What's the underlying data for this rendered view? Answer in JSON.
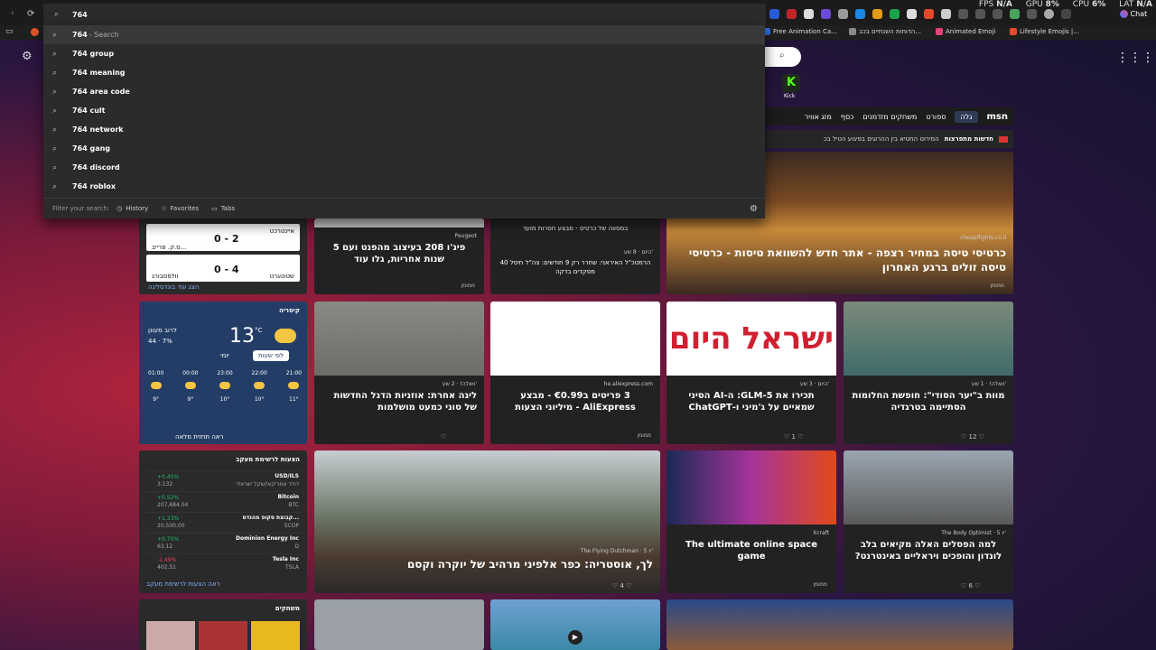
{
  "browser": {
    "typed_query": "764",
    "perf": {
      "fps_label": "FPS",
      "fps": "N/A",
      "gpu_label": "GPU",
      "gpu": "8%",
      "cpu_label": "CPU",
      "cpu": "6%",
      "lat_label": "LAT",
      "lat": "N/A"
    },
    "chat_label": "Chat",
    "bookmarks": [
      "Free Animation Ca...",
      "הדוחות השנתיים בכב...",
      "Animated Emoji",
      "Lifestyle Emojis |..."
    ]
  },
  "suggestions": {
    "first": {
      "text": "764",
      "suffix": " - Search"
    },
    "items": [
      "764 group",
      "764 meaning",
      "764 area code",
      "764 cult",
      "764 network",
      "764 gang",
      "764 discord",
      "764 roblox"
    ],
    "filter_label": "Filter your search:",
    "filters": [
      "History",
      "Favorites",
      "Tabs"
    ]
  },
  "page": {
    "kick_label": "Kick",
    "msn": {
      "logo": "msn",
      "tabs": [
        "גלה",
        "ספורט",
        "משחקים מזדמנים",
        "כסף",
        "מזג אוויר"
      ]
    },
    "ticker": {
      "label": "חדשות מתפרצות",
      "text": "המירוט החטיא בין ההרוגים בפיגוע הטיל בכ"
    },
    "sports": {
      "team1": "איינטרכט",
      "score1": "0 - 2",
      "team2": "ס.ק. פרייב...",
      "team3": "שטוטגרט",
      "score2": "0 - 4",
      "team4": "וולפסבורג",
      "more": "הצג עוד בונדסליגה"
    },
    "cards": [
      {
        "title": "פיג'ו 208 בעיצוב מהפנט ועם 5 שנות אחריות, גלו עוד",
        "src": "Peugeot",
        "foot": "ממומן"
      },
      {
        "title": "במסווה של כרטיס - מבצע חסרות מועד",
        "sub": "הרמטכ\"ל האיראני: שחרר רק 9 חודשים: צה\"ל חיסל 40 מפקדים בדקה",
        "src": "היום · 8 שע'"
      },
      {
        "title": "כרטיסי טיסה במחיר רצפה - אתר חדש להשוואת טיסות - כרטיסי טיסה זולים ברגע האחרון",
        "src": "cheapflights.co.il",
        "foot": "ממומן"
      },
      {
        "title": "ליגה אחרת: אוזניות הדגל החדשות של סוני כמעט מושלמות",
        "src": "וואלה! · 2 שע'",
        "likes": ""
      },
      {
        "title": "3 פריטים ב‎€0.99 - מבצע AliExpress - מיליוני הצעות",
        "src": "he.aliexpress.com",
        "foot": "ממומן"
      },
      {
        "title": "תכירו את GLM-5: ה-AI הסיני שמאיים על ג'מיני ו-ChatGPT",
        "src": "היום · 3 שע'",
        "likes": "1"
      },
      {
        "title": "מוות ב\"יער הסודי\": חופשת החלומות הסתיימה בטרגדיה",
        "src": "וואלה! · 1 שע'",
        "likes": "12"
      },
      {
        "title": "לך, אוסטריה: כפר אלפיני מרהיב של יוקרה וקסם",
        "src": "The Flying Dutchman · 5 יו'",
        "likes": "4"
      },
      {
        "title": "The ultimate online space game",
        "src": "Xcraft",
        "foot": "ממומן"
      },
      {
        "title": "למה הפסלים האלה מקיאים בלב לונדון והופכים ויראליים באינטרנט?",
        "src": "The Body Optimist · 5 יו'",
        "likes": "6"
      }
    ],
    "weather": {
      "city": "קיסריה",
      "temp": "13",
      "unit": "°C",
      "desc": "לרוב מעונן",
      "hi": "44",
      "rain": "7%",
      "tab1": "לפי שעות",
      "tab2": "יומי",
      "hours": [
        "21:00",
        "22:00",
        "23:00",
        "00:00",
        "01:00"
      ],
      "temps": [
        "11°",
        "10°",
        "10°",
        "9°",
        "9°"
      ],
      "more": "ראה תחזית מלאה"
    },
    "stocks": {
      "title": "הצעות לרשימת מעקב",
      "more": "ראה הצעות לרשימת מעקב",
      "rows": [
        {
          "name": "USD/ILS",
          "sub": "דולר אמריקאי/שקל ישראלי",
          "chg": "+0.45%",
          "val": "3.132",
          "color": "#1fb86d"
        },
        {
          "name": "Bitcoin",
          "sub": "BTC",
          "chg": "+0.52%",
          "val": "207,684.04",
          "color": "#1fb86d"
        },
        {
          "name": "קבוצת סקופ מהנדס...",
          "sub": "SCOP",
          "chg": "+1.33%",
          "val": "20,500.00",
          "color": "#1fb86d"
        },
        {
          "name": "Dominion Energy Inc",
          "sub": "D",
          "chg": "+0.70%",
          "val": "63.12",
          "color": "#1fb86d"
        },
        {
          "name": "Tesla Inc",
          "sub": "TSLA",
          "chg": "-1.49%",
          "val": "402.51",
          "color": "#e2435c"
        }
      ]
    },
    "games_label": "משחקים"
  }
}
